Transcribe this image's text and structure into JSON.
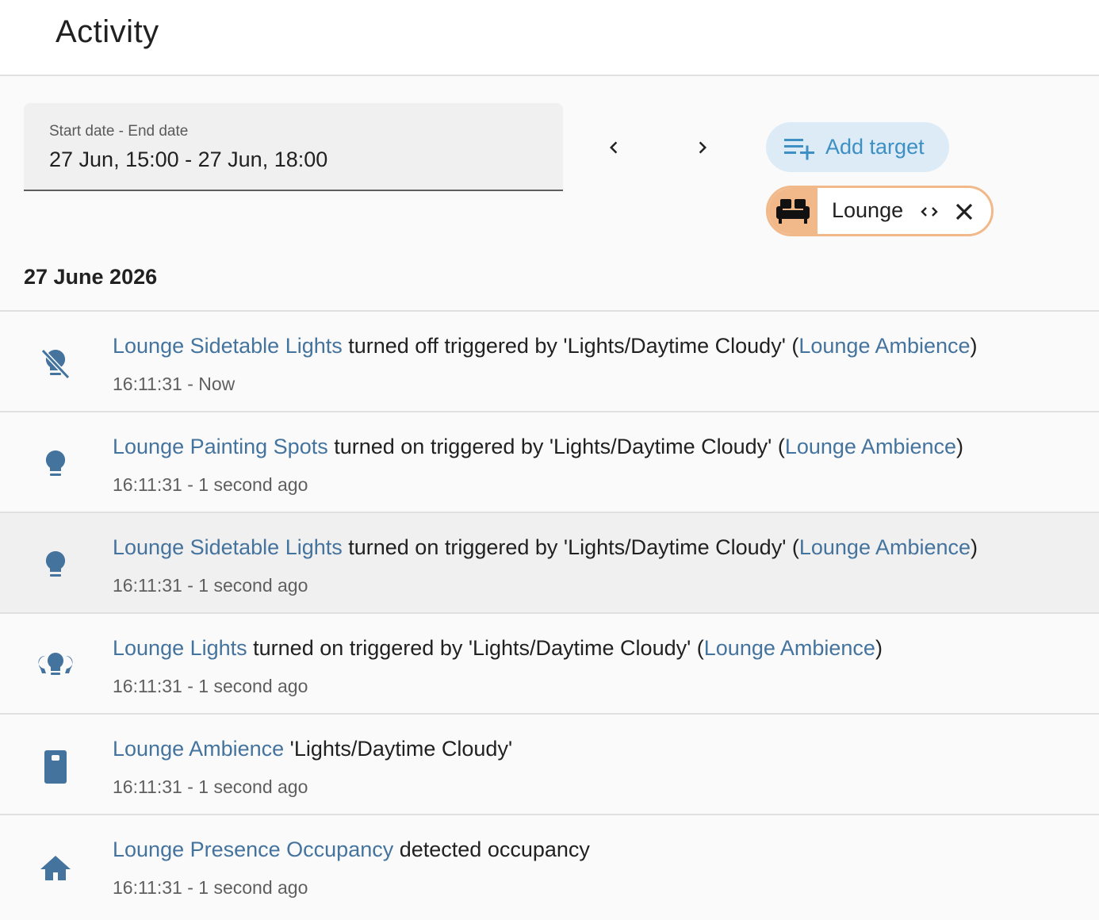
{
  "header": {
    "title": "Activity"
  },
  "date_range": {
    "label": "Start date - End date",
    "value": "27 Jun, 15:00 - 27 Jun, 18:00"
  },
  "nav": {
    "prev_icon": "chevron-left-icon",
    "next_icon": "chevron-right-icon"
  },
  "add_target": {
    "label": "Add target",
    "icon": "playlist-plus-icon"
  },
  "target_chip": {
    "label": "Lounge",
    "icon": "sofa-icon",
    "color": "#f1b98a"
  },
  "date_header": "27 June 2026",
  "colors": {
    "link": "#44739e",
    "icon": "#44739e",
    "accent": "#3d8fc4"
  },
  "entries": [
    {
      "icon": "lightbulb-off-icon",
      "entity": "Lounge Sidetable Lights",
      "message": " turned off triggered by 'Lights/Daytime Cloudy' (",
      "context": "Lounge Ambience",
      "suffix": ")",
      "time": "16:11:31 - Now"
    },
    {
      "icon": "lightbulb-icon",
      "entity": "Lounge Painting Spots",
      "message": " turned on triggered by 'Lights/Daytime Cloudy' (",
      "context": "Lounge Ambience",
      "suffix": ")",
      "time": "16:11:31 - 1 second ago"
    },
    {
      "icon": "lightbulb-icon",
      "entity": "Lounge Sidetable Lights",
      "message": " turned on triggered by 'Lights/Daytime Cloudy' (",
      "context": "Lounge Ambience",
      "suffix": ")",
      "time": "16:11:31 - 1 second ago"
    },
    {
      "icon": "lightbulb-group-icon",
      "entity": "Lounge Lights",
      "message": " turned on triggered by 'Lights/Daytime Cloudy' (",
      "context": "Lounge Ambience",
      "suffix": ")",
      "time": "16:11:31 - 1 second ago"
    },
    {
      "icon": "remote-icon",
      "entity": "Lounge Ambience",
      "message": " 'Lights/Daytime Cloudy'",
      "context": "",
      "suffix": "",
      "time": "16:11:31 - 1 second ago"
    },
    {
      "icon": "home-icon",
      "entity": "Lounge Presence Occupancy",
      "message": " detected occupancy",
      "context": "",
      "suffix": "",
      "time": "16:11:31 - 1 second ago"
    }
  ]
}
